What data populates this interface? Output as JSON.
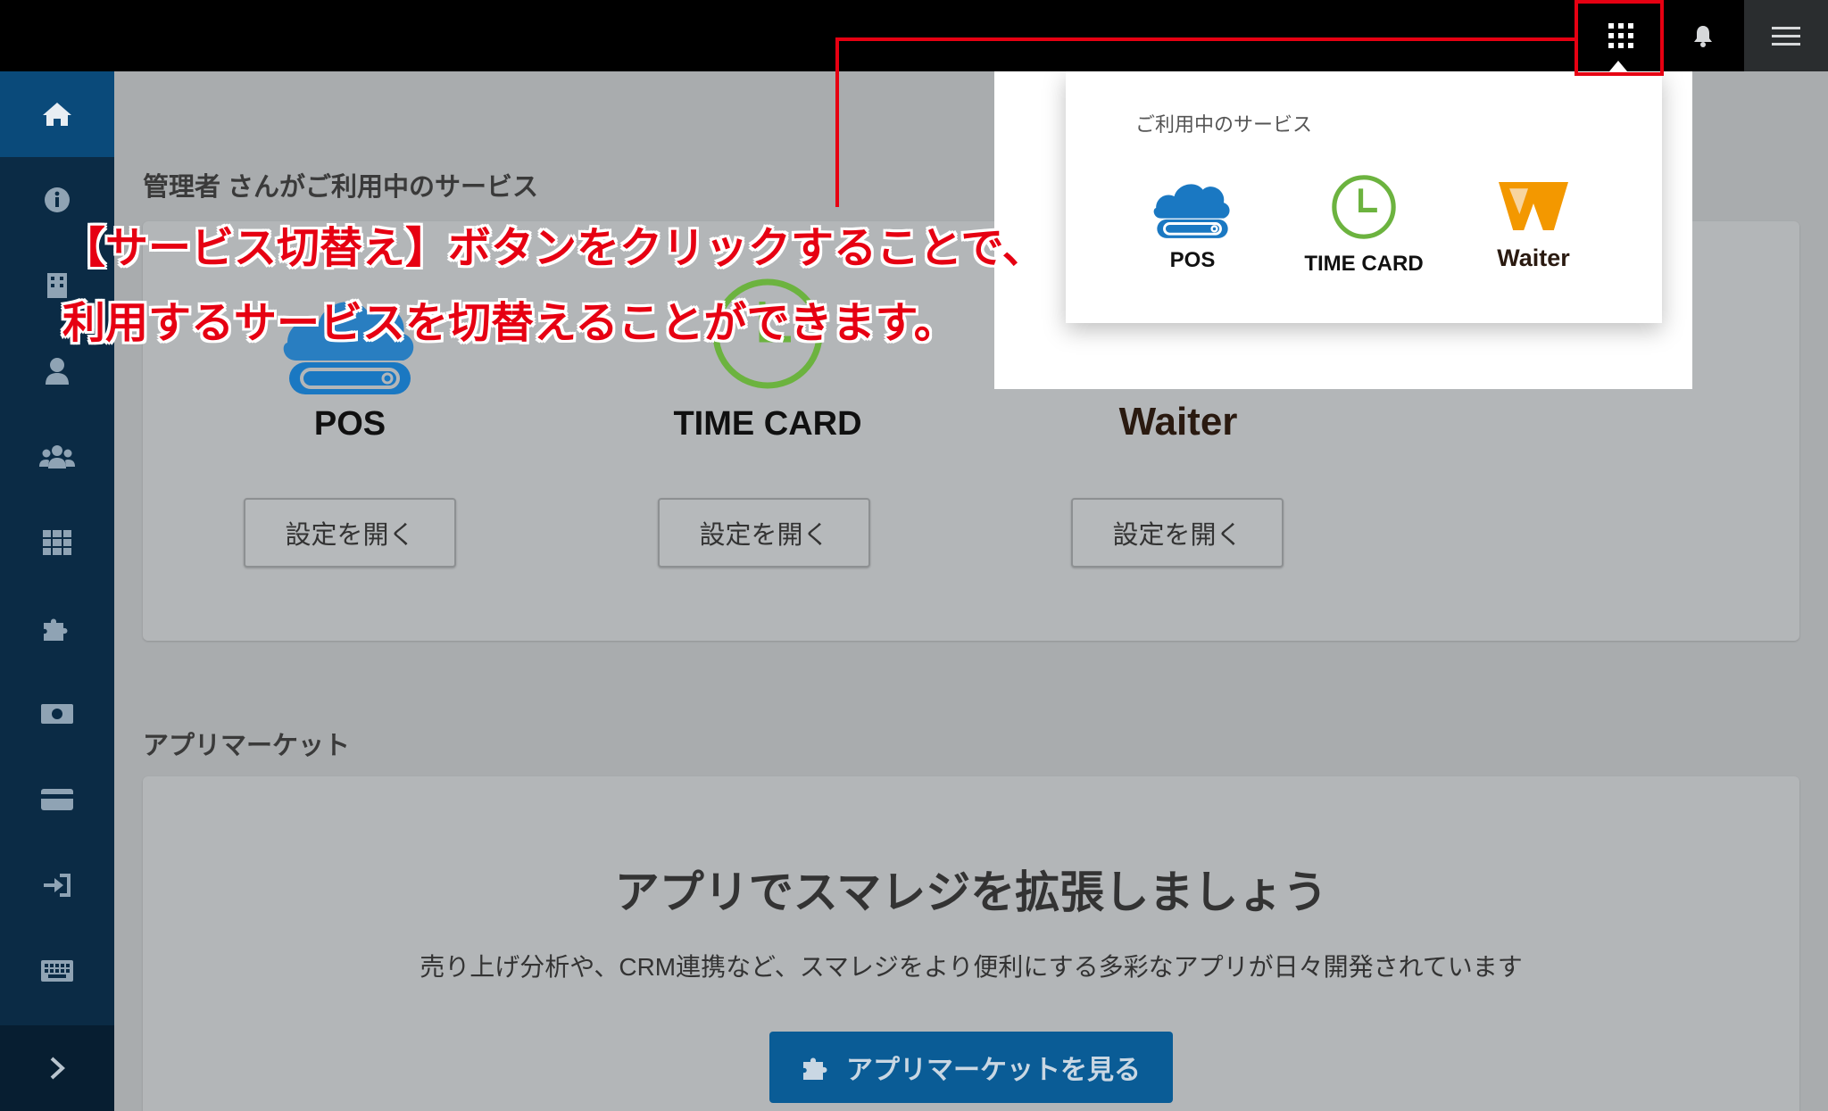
{
  "colors": {
    "annotation_red": "#e60012",
    "sidebar_bg": "#0b2b45",
    "sidebar_active": "#0a4a7a",
    "primary_button": "#0a5c96",
    "pos_blue": "#1a78c2",
    "timecard_green": "#6cb33f",
    "waiter_orange": "#f39800"
  },
  "topbar": {
    "icons": [
      "apps-grid-icon",
      "bell-icon",
      "hamburger-menu-icon"
    ]
  },
  "sidebar": {
    "items": [
      {
        "icon": "home-icon"
      },
      {
        "icon": "info-icon"
      },
      {
        "icon": "building-icon"
      },
      {
        "icon": "user-icon"
      },
      {
        "icon": "users-icon"
      },
      {
        "icon": "grid-icon"
      },
      {
        "icon": "puzzle-icon"
      },
      {
        "icon": "money-icon"
      },
      {
        "icon": "credit-card-icon"
      },
      {
        "icon": "sign-in-icon"
      },
      {
        "icon": "keyboard-icon"
      }
    ],
    "expand_icon": "chevron-right-icon"
  },
  "main": {
    "services_title": "管理者 さんがご利用中のサービス",
    "services": [
      {
        "name": "POS",
        "button": "設定を開く"
      },
      {
        "name": "TIME CARD",
        "button": "設定を開く"
      },
      {
        "name": "Waiter",
        "button": "設定を開く"
      }
    ],
    "market_title": "アプリマーケット",
    "market_headline": "アプリでスマレジを拡張しましょう",
    "market_description": "売り上げ分析や、CRM連携など、スマレジをより便利にする多彩なアプリが日々開発されています",
    "market_button": "アプリマーケットを見る"
  },
  "dropdown": {
    "title": "ご利用中のサービス",
    "services": [
      {
        "name": "POS"
      },
      {
        "name": "TIME CARD"
      },
      {
        "name": "Waiter"
      }
    ]
  },
  "annotation": {
    "line1": "【サービス切替え】ボタンをクリックすることで、",
    "line2": "利用するサービスを切替えることができます。"
  }
}
